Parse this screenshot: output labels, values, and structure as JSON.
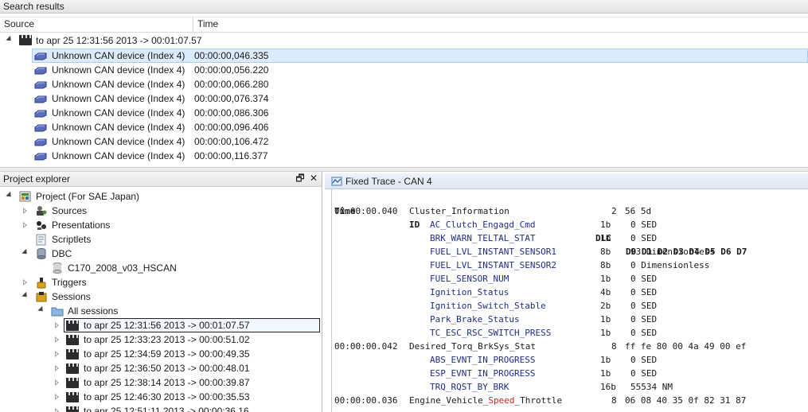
{
  "search_results": {
    "title": "Search results",
    "columns": [
      "Source",
      "Time"
    ],
    "parent": "to apr 25 12:31:56 2013 -> 00:01:07.57",
    "rows": [
      {
        "source": "Unknown CAN device (Index 4)",
        "time": "00:00:00,046.335"
      },
      {
        "source": "Unknown CAN device (Index 4)",
        "time": "00:00:00,056.220"
      },
      {
        "source": "Unknown CAN device (Index 4)",
        "time": "00:00:00,066.280"
      },
      {
        "source": "Unknown CAN device (Index 4)",
        "time": "00:00:00,076.374"
      },
      {
        "source": "Unknown CAN device (Index 4)",
        "time": "00:00:00,086.306"
      },
      {
        "source": "Unknown CAN device (Index 4)",
        "time": "00:00:00,096.406"
      },
      {
        "source": "Unknown CAN device (Index 4)",
        "time": "00:00:00,106.472"
      },
      {
        "source": "Unknown CAN device (Index 4)",
        "time": "00:00:00,116.377"
      }
    ]
  },
  "explorer": {
    "title": "Project explorer",
    "restore_glyph": "🗗",
    "close_glyph": "✕",
    "project": "Project (For SAE Japan)",
    "sources": "Sources",
    "presentations": "Presentations",
    "scriptlets": "Scriptlets",
    "dbc": "DBC",
    "dbc_file": "C170_2008_v03_HSCAN",
    "triggers": "Triggers",
    "sessions": "Sessions",
    "all_sessions": "All sessions",
    "session_list": [
      "to apr 25 12:31:56 2013 -> 00:01:07.57",
      "to apr 25 12:33:23 2013 -> 00:00:51.02",
      "to apr 25 12:34:59 2013 -> 00:00:49.35",
      "to apr 25 12:36:50 2013 -> 00:00:48.01",
      "to apr 25 12:38:14 2013 -> 00:00:39.87",
      "to apr 25 12:46:30 2013 -> 00:00:35.53",
      "to apr 25 12:51:11 2013 -> 00:00:36.16"
    ]
  },
  "trace": {
    "tab_title": "Fixed Trace - CAN 4",
    "headers": {
      "time": "Time",
      "id": "ID",
      "dlc": "DLC",
      "data": "D0 D1 D2 D3 D4 D5 D6 D7"
    },
    "rows": [
      {
        "time": "00:00:00.040",
        "id": "Cluster_Information",
        "dlc": "2",
        "data": "56 5d",
        "kind": "msg"
      },
      {
        "id": "AC_Clutch_Engagd_Cmd",
        "dlc": "1b",
        "data": "0 SED",
        "kind": "sig"
      },
      {
        "id": "BRK_WARN_TELTAL_STAT",
        "dlc": "1b",
        "data": "0 SED",
        "kind": "sig"
      },
      {
        "id": "FUEL_LVL_INSTANT_SENSOR1",
        "dlc": "8b",
        "data": "93 Dimensionless",
        "kind": "sig"
      },
      {
        "id": "FUEL_LVL_INSTANT_SENSOR2",
        "dlc": "8b",
        "data": "0 Dimensionless",
        "kind": "sig"
      },
      {
        "id": "FUEL_SENSOR_NUM",
        "dlc": "1b",
        "data": "0 SED",
        "kind": "sig"
      },
      {
        "id": "Ignition_Status",
        "dlc": "4b",
        "data": "0 SED",
        "kind": "sig"
      },
      {
        "id": "Ignition_Switch_Stable",
        "dlc": "2b",
        "data": "0 SED",
        "kind": "sig"
      },
      {
        "id": "Park_Brake_Status",
        "dlc": "1b",
        "data": "0 SED",
        "kind": "sig"
      },
      {
        "id": "TC_ESC_RSC_SWITCH_PRESS",
        "dlc": "1b",
        "data": "0 SED",
        "kind": "sig"
      },
      {
        "time": "00:00:00.042",
        "id": "Desired_Torq_BrkSys_Stat",
        "dlc": "8",
        "data": "ff fe 80 00 4a 49 00 ef",
        "kind": "msg"
      },
      {
        "id": "ABS_EVNT_IN_PROGRESS",
        "dlc": "1b",
        "data": "0 SED",
        "kind": "sig"
      },
      {
        "id": "ESP_EVNT_IN_PROGRESS",
        "dlc": "1b",
        "data": "0 SED",
        "kind": "sig"
      },
      {
        "id": "TRQ_RQST_BY_BRK",
        "dlc": "16b",
        "data": "55534 NM",
        "kind": "sig"
      },
      {
        "time": "00:00:00.036",
        "id_pre": "Engine_Vehicle_",
        "id_hl": "Speed",
        "id_post": "_Throttle",
        "dlc": "8",
        "data": "06 08 40 35 0f 82 31 87",
        "kind": "msg-hl"
      }
    ]
  },
  "colors": {
    "selection": "#dcebfc",
    "signal_text": "#1f2d8a",
    "highlight": "#d32020"
  }
}
